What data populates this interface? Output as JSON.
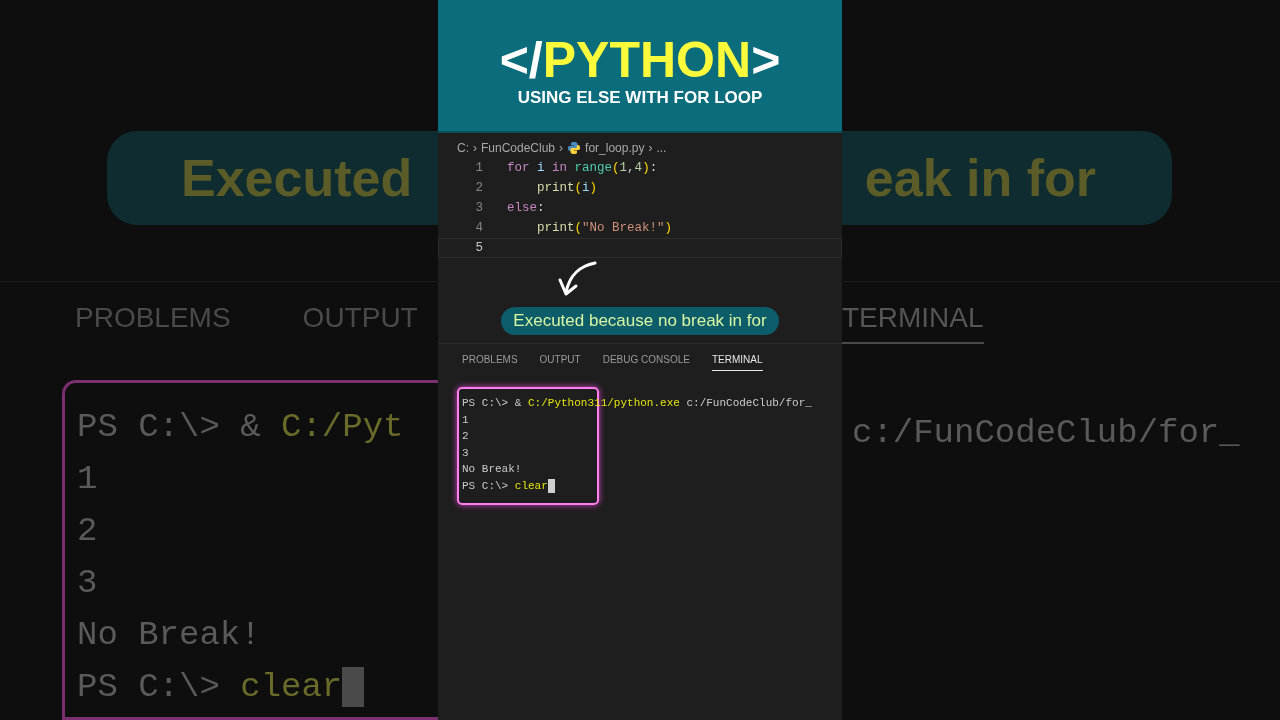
{
  "backdrop": {
    "left": {
      "banner": "Executed",
      "tabs": [
        "PROBLEMS",
        "OUTPUT"
      ],
      "terminal_lines": [
        {
          "parts": [
            {
              "text": "PS C:\\> & ",
              "kind": "plain"
            },
            {
              "text": "C:/Pyt",
              "kind": "path"
            }
          ],
          "cursor": false
        },
        {
          "parts": [
            {
              "text": "1",
              "kind": "plain"
            }
          ],
          "cursor": false
        },
        {
          "parts": [
            {
              "text": "2",
              "kind": "plain"
            }
          ],
          "cursor": false
        },
        {
          "parts": [
            {
              "text": "3",
              "kind": "plain"
            }
          ],
          "cursor": false
        },
        {
          "parts": [
            {
              "text": "No Break!",
              "kind": "plain"
            }
          ],
          "cursor": false
        },
        {
          "parts": [
            {
              "text": "PS C:\\> ",
              "kind": "plain"
            },
            {
              "text": "clear",
              "kind": "path"
            }
          ],
          "cursor": true
        }
      ]
    },
    "right": {
      "banner": "eak in for",
      "tab": {
        "label": "TERMINAL",
        "selected": true
      },
      "terminal_line": "c:/FunCodeClub/for_"
    }
  },
  "header": {
    "title": {
      "prefix": "</",
      "word": "PYTHON",
      "suffix": ">"
    },
    "subtitle": "USING ELSE WITH FOR LOOP"
  },
  "breadcrumb": [
    {
      "text": "C:",
      "kind": "item"
    },
    {
      "text": "›",
      "kind": "separator"
    },
    {
      "text": "FunCodeClub",
      "kind": "item"
    },
    {
      "text": "›",
      "kind": "separator"
    },
    {
      "text": "for_loop.py",
      "kind": "file"
    },
    {
      "text": "›",
      "kind": "separator"
    },
    {
      "text": "...",
      "kind": "item"
    }
  ],
  "code": [
    {
      "number": "1",
      "current": false,
      "tokens": [
        {
          "text": "for ",
          "kind": "keyword"
        },
        {
          "text": "i ",
          "kind": "var"
        },
        {
          "text": "in ",
          "kind": "keyword"
        },
        {
          "text": "range",
          "kind": "builtin"
        },
        {
          "text": "(",
          "kind": "paren"
        },
        {
          "text": "1",
          "kind": "num"
        },
        {
          "text": ",",
          "kind": "plain"
        },
        {
          "text": "4",
          "kind": "num"
        },
        {
          "text": ")",
          "kind": "paren"
        },
        {
          "text": ":",
          "kind": "plain"
        }
      ],
      "children": [
        {
          "number": "2",
          "current": false,
          "tokens": [
            {
              "text": "print",
              "kind": "func"
            },
            {
              "text": "(",
              "kind": "paren"
            },
            {
              "text": "i",
              "kind": "var"
            },
            {
              "text": ")",
              "kind": "paren"
            }
          ]
        }
      ]
    },
    {
      "number": "3",
      "current": false,
      "tokens": [
        {
          "text": "else",
          "kind": "keyword"
        },
        {
          "text": ":",
          "kind": "plain"
        }
      ],
      "children": [
        {
          "number": "4",
          "current": false,
          "tokens": [
            {
              "text": "print",
              "kind": "func"
            },
            {
              "text": "(",
              "kind": "paren"
            },
            {
              "text": "\"No Break!\"",
              "kind": "string"
            },
            {
              "text": ")",
              "kind": "paren"
            }
          ]
        }
      ]
    },
    {
      "number": "5",
      "current": true
    }
  ],
  "annotation": "Executed because no break in for",
  "panel_tabs": [
    {
      "label": "PROBLEMS",
      "selected": false
    },
    {
      "label": "OUTPUT",
      "selected": false
    },
    {
      "label": "DEBUG CONSOLE",
      "selected": false
    },
    {
      "label": "TERMINAL",
      "selected": true
    }
  ],
  "terminal": {
    "lines": [
      {
        "parts": [
          {
            "text": "PS C:\\> & ",
            "kind": "plain"
          },
          {
            "text": "C:/Python311/python.exe",
            "kind": "path"
          },
          {
            "text": " c:/FunCodeClub/for_",
            "kind": "plain"
          }
        ],
        "cursor": false
      },
      {
        "parts": [
          {
            "text": "1",
            "kind": "plain"
          }
        ],
        "cursor": false
      },
      {
        "parts": [
          {
            "text": "2",
            "kind": "plain"
          }
        ],
        "cursor": false
      },
      {
        "parts": [
          {
            "text": "3",
            "kind": "plain"
          }
        ],
        "cursor": false
      },
      {
        "parts": [
          {
            "text": "No Break!",
            "kind": "plain"
          }
        ],
        "cursor": false
      },
      {
        "parts": [
          {
            "text": "PS C:\\> ",
            "kind": "plain"
          },
          {
            "text": "clear",
            "kind": "path"
          }
        ],
        "cursor": true
      }
    ]
  }
}
